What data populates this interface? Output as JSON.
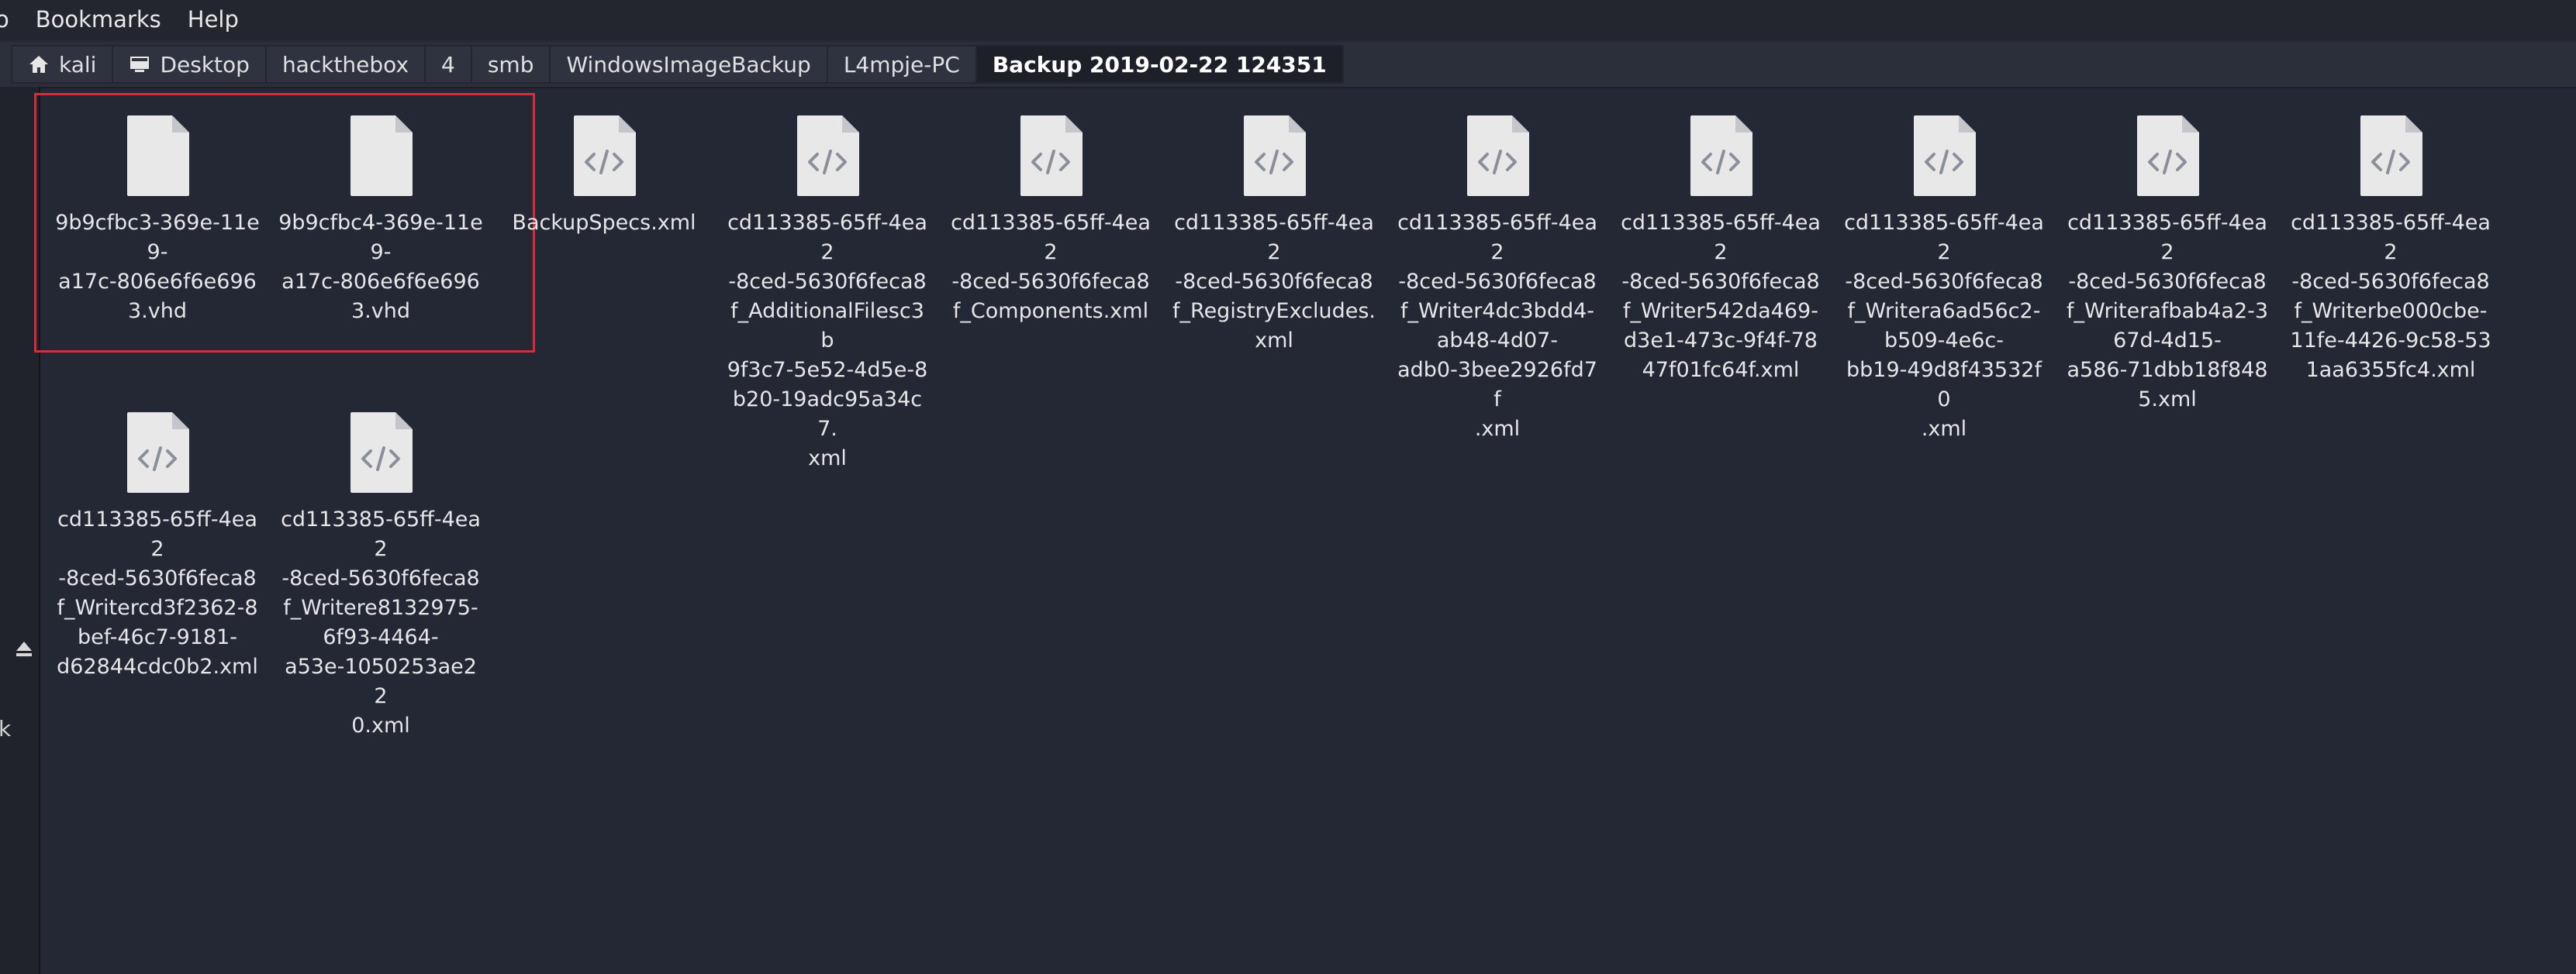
{
  "menubar": {
    "items": [
      "Go",
      "Bookmarks",
      "Help"
    ],
    "visible_go": "o"
  },
  "pathbar": {
    "crumbs": [
      "kali",
      "Desktop",
      "hackthebox",
      "4",
      "smb",
      "WindowsImageBackup",
      "L4mpje-PC",
      "Backup 2019-02-22 124351"
    ]
  },
  "sidebar": {
    "cut_label": "k"
  },
  "files": [
    {
      "name": "9b9cfbc3-369e-11e9-a17c-806e6f6e6963.vhd",
      "lines": [
        "9b9cfbc3-369e-11e",
        "9-",
        "a17c-806e6f6e696",
        "3.vhd"
      ],
      "type": "vhd"
    },
    {
      "name": "9b9cfbc4-369e-11e9-a17c-806e6f6e6963.vhd",
      "lines": [
        "9b9cfbc4-369e-11e",
        "9-",
        "a17c-806e6f6e696",
        "3.vhd"
      ],
      "type": "vhd"
    },
    {
      "name": "BackupSpecs.xml",
      "lines": [
        "BackupSpecs.xml"
      ],
      "type": "xml"
    },
    {
      "name": "cd113385-65ff-4ea2-8ced-5630f6feca8f_AdditionalFilesc3b9f3c7-5e52-4d5e-8b20-19adc95a34c7.xml",
      "lines": [
        "cd113385-65ff-4ea2",
        "-8ced-5630f6feca8",
        "f_AdditionalFilesc3b",
        "9f3c7-5e52-4d5e-8",
        "b20-19adc95a34c7.",
        "xml"
      ],
      "type": "xml"
    },
    {
      "name": "cd113385-65ff-4ea2-8ced-5630f6feca8f_Components.xml",
      "lines": [
        "cd113385-65ff-4ea2",
        "-8ced-5630f6feca8",
        "f_Components.xml"
      ],
      "type": "xml"
    },
    {
      "name": "cd113385-65ff-4ea2-8ced-5630f6feca8f_RegistryExcludes.xml",
      "lines": [
        "cd113385-65ff-4ea2",
        "-8ced-5630f6feca8",
        "f_RegistryExcludes.",
        "xml"
      ],
      "type": "xml"
    },
    {
      "name": "cd113385-65ff-4ea2-8ced-5630f6feca8f_Writer4dc3bdd4-ab48-4d07-adb0-3bee2926fd7f.xml",
      "lines": [
        "cd113385-65ff-4ea2",
        "-8ced-5630f6feca8",
        "f_Writer4dc3bdd4-",
        "ab48-4d07-",
        "adb0-3bee2926fd7f",
        ".xml"
      ],
      "type": "xml"
    },
    {
      "name": "cd113385-65ff-4ea2-8ced-5630f6feca8f_Writer542da469-d3e1-473c-9f4f-7847f01fc64f.xml",
      "lines": [
        "cd113385-65ff-4ea2",
        "-8ced-5630f6feca8",
        "f_Writer542da469-",
        "d3e1-473c-9f4f-78",
        "47f01fc64f.xml"
      ],
      "type": "xml"
    },
    {
      "name": "cd113385-65ff-4ea2-8ced-5630f6feca8f_Writera6ad56c2-b509-4e6c-bb19-49d8f43532f0.xml",
      "lines": [
        "cd113385-65ff-4ea2",
        "-8ced-5630f6feca8",
        "f_Writera6ad56c2-",
        "b509-4e6c-",
        "bb19-49d8f43532f0",
        ".xml"
      ],
      "type": "xml"
    },
    {
      "name": "cd113385-65ff-4ea2-8ced-5630f6feca8f_Writerafbab4a2-367d-4d15-a586-71dbb18f8485.xml",
      "lines": [
        "cd113385-65ff-4ea2",
        "-8ced-5630f6feca8",
        "f_Writerafbab4a2-3",
        "67d-4d15-",
        "a586-71dbb18f848",
        "5.xml"
      ],
      "type": "xml"
    },
    {
      "name": "cd113385-65ff-4ea2-8ced-5630f6feca8f_Writerbe000cbe-11fe-4426-9c58-531aa6355fc4.xml",
      "lines": [
        "cd113385-65ff-4ea2",
        "-8ced-5630f6feca8",
        "f_Writerbe000cbe-",
        "11fe-4426-9c58-53",
        "1aa6355fc4.xml"
      ],
      "type": "xml"
    },
    {
      "name": "cd113385-65ff-4ea2-8ced-5630f6feca8f_Writercd3f2362-8bef-46c7-9181-d62844cdc0b2.xml",
      "lines": [
        "cd113385-65ff-4ea2",
        "-8ced-5630f6feca8",
        "f_Writercd3f2362-8",
        "bef-46c7-9181-",
        "d62844cdc0b2.xml"
      ],
      "type": "xml"
    },
    {
      "name": "cd113385-65ff-4ea2-8ced-5630f6feca8f_Writere8132975-6f93-4464-a53e-1050253ae220.xml",
      "lines": [
        "cd113385-65ff-4ea2",
        "-8ced-5630f6feca8",
        "f_Writere8132975-",
        "6f93-4464-",
        "a53e-1050253ae22",
        "0.xml"
      ],
      "type": "xml"
    }
  ],
  "colors": {
    "selection_border": "#d42d3c",
    "background": "#242834",
    "icon_fill": "#e8e8e8",
    "icon_glyph": "#8a8f99"
  }
}
